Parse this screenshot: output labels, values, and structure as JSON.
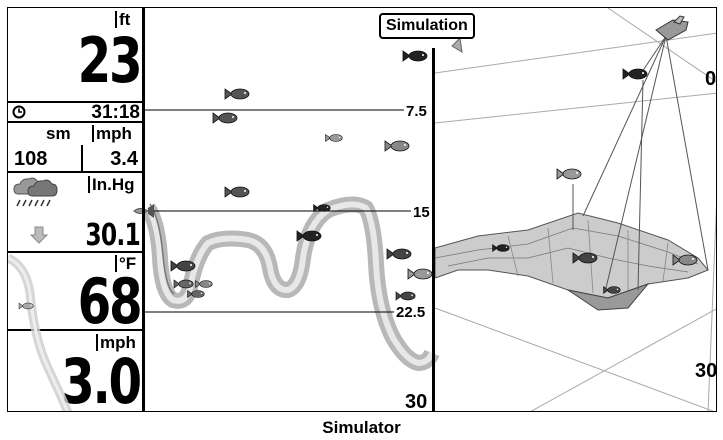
{
  "title": "Simulation",
  "caption": "Simulator",
  "readouts": {
    "depth_unit": "ft",
    "depth_value": "23",
    "timer": "31:18",
    "speed_unit_left": "sm",
    "speed_unit_right": "mph",
    "distance_value": "108",
    "speed_value": "3.4",
    "pressure_unit": "In.Hg",
    "pressure_value": "30.1",
    "temp_unit": "°F",
    "temp_value": "68",
    "speed2_unit": "mph",
    "speed2_value": "3.0"
  },
  "icons": {
    "timer": "clock-icon",
    "weather": "rain-cloud-icon",
    "trend": "down-arrow-icon",
    "fish": "fish-icon",
    "boat": "boat-icon"
  },
  "sonar_scale": {
    "ticks": [
      "7.5",
      "15",
      "22.5"
    ],
    "bottom": "30"
  },
  "view3d_scale": {
    "top": "0",
    "bottom": "30"
  }
}
